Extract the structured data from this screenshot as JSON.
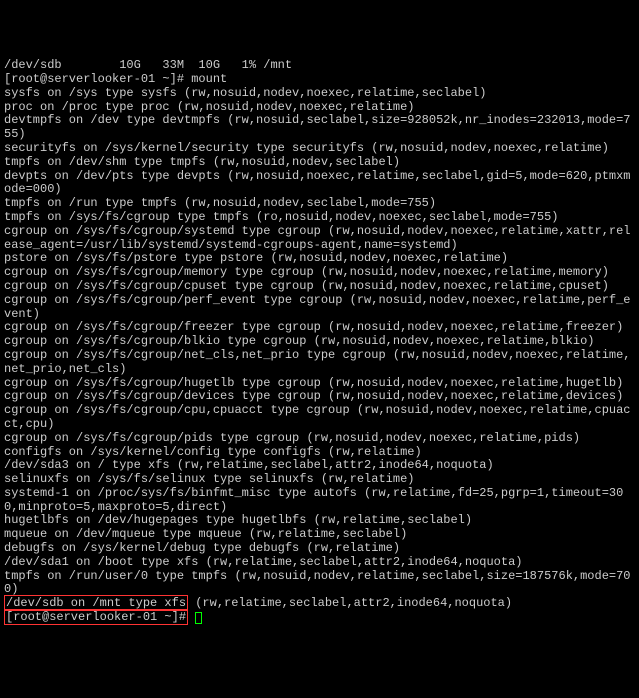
{
  "lines": [
    "/dev/sdb        10G   33M  10G   1% /mnt",
    "[root@serverlooker-01 ~]# mount",
    "sysfs on /sys type sysfs (rw,nosuid,nodev,noexec,relatime,seclabel)",
    "proc on /proc type proc (rw,nosuid,nodev,noexec,relatime)",
    "devtmpfs on /dev type devtmpfs (rw,nosuid,seclabel,size=928052k,nr_inodes=232013,mode=755)",
    "securityfs on /sys/kernel/security type securityfs (rw,nosuid,nodev,noexec,relatime)",
    "tmpfs on /dev/shm type tmpfs (rw,nosuid,nodev,seclabel)",
    "devpts on /dev/pts type devpts (rw,nosuid,noexec,relatime,seclabel,gid=5,mode=620,ptmxmode=000)",
    "tmpfs on /run type tmpfs (rw,nosuid,nodev,seclabel,mode=755)",
    "tmpfs on /sys/fs/cgroup type tmpfs (ro,nosuid,nodev,noexec,seclabel,mode=755)",
    "cgroup on /sys/fs/cgroup/systemd type cgroup (rw,nosuid,nodev,noexec,relatime,xattr,release_agent=/usr/lib/systemd/systemd-cgroups-agent,name=systemd)",
    "pstore on /sys/fs/pstore type pstore (rw,nosuid,nodev,noexec,relatime)",
    "cgroup on /sys/fs/cgroup/memory type cgroup (rw,nosuid,nodev,noexec,relatime,memory)",
    "cgroup on /sys/fs/cgroup/cpuset type cgroup (rw,nosuid,nodev,noexec,relatime,cpuset)",
    "cgroup on /sys/fs/cgroup/perf_event type cgroup (rw,nosuid,nodev,noexec,relatime,perf_event)",
    "cgroup on /sys/fs/cgroup/freezer type cgroup (rw,nosuid,nodev,noexec,relatime,freezer)",
    "cgroup on /sys/fs/cgroup/blkio type cgroup (rw,nosuid,nodev,noexec,relatime,blkio)",
    "cgroup on /sys/fs/cgroup/net_cls,net_prio type cgroup (rw,nosuid,nodev,noexec,relatime,net_prio,net_cls)",
    "cgroup on /sys/fs/cgroup/hugetlb type cgroup (rw,nosuid,nodev,noexec,relatime,hugetlb)",
    "cgroup on /sys/fs/cgroup/devices type cgroup (rw,nosuid,nodev,noexec,relatime,devices)",
    "cgroup on /sys/fs/cgroup/cpu,cpuacct type cgroup (rw,nosuid,nodev,noexec,relatime,cpuacct,cpu)",
    "cgroup on /sys/fs/cgroup/pids type cgroup (rw,nosuid,nodev,noexec,relatime,pids)",
    "configfs on /sys/kernel/config type configfs (rw,relatime)",
    "/dev/sda3 on / type xfs (rw,relatime,seclabel,attr2,inode64,noquota)",
    "selinuxfs on /sys/fs/selinux type selinuxfs (rw,relatime)",
    "systemd-1 on /proc/sys/fs/binfmt_misc type autofs (rw,relatime,fd=25,pgrp=1,timeout=300,minproto=5,maxproto=5,direct)",
    "hugetlbfs on /dev/hugepages type hugetlbfs (rw,relatime,seclabel)",
    "mqueue on /dev/mqueue type mqueue (rw,relatime,seclabel)",
    "debugfs on /sys/kernel/debug type debugfs (rw,relatime)",
    "/dev/sda1 on /boot type xfs (rw,relatime,seclabel,attr2,inode64,noquota)",
    "tmpfs on /run/user/0 type tmpfs (rw,nosuid,nodev,relatime,seclabel,size=187576k,mode=700)"
  ],
  "highlighted": {
    "part1": "/dev/sdb on /mnt type xfs",
    "part2": " (rw,relatime,seclabel,attr2,inode64,noquota)",
    "prompt": "[root@serverlooker-01 ~]#"
  }
}
